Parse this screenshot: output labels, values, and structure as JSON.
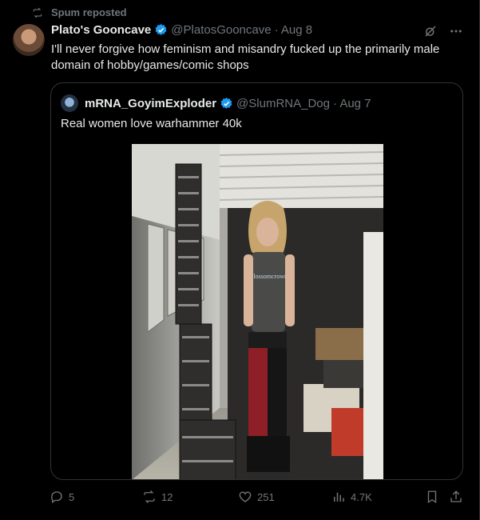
{
  "repost": {
    "label": "Spum reposted"
  },
  "tweet": {
    "author_name": "Plato's Gooncave",
    "handle": "@PlatosGooncave",
    "date": "· Aug 8",
    "text": "I'll never forgive how feminism and misandry fucked up the primarily male domain of hobby/games/comic shops"
  },
  "quote": {
    "author_name": "mRNA_GoyimExploder",
    "handle": "@SlumRNA_Dog",
    "date": "· Aug 7",
    "text": "Real women love warhammer 40k",
    "photo_shirt_text": "Blossomcrown"
  },
  "actions": {
    "replies": "5",
    "reposts": "12",
    "likes": "251",
    "views": "4.7K"
  },
  "colors": {
    "verified": "#1d9bf0",
    "muted": "#71767b",
    "border": "#2f3336"
  }
}
